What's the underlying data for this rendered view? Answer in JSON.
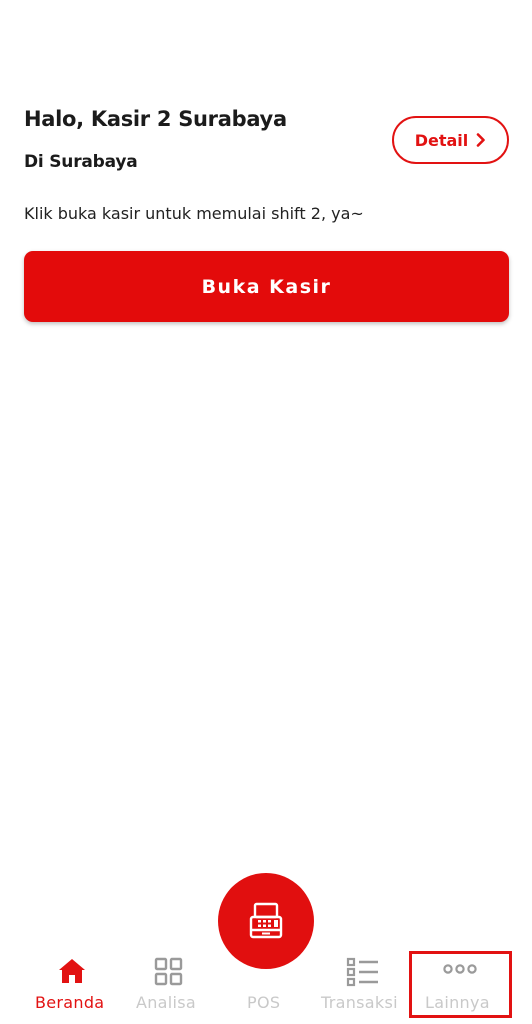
{
  "header": {
    "greeting": "Halo, Kasir 2 Surabaya",
    "location": "Di Surabaya",
    "detail_label": "Detail"
  },
  "main": {
    "instruction": "Klik buka kasir untuk memulai shift 2, ya~",
    "open_cashier_label": "Buka Kasir"
  },
  "bottom_nav": {
    "items": [
      {
        "label": "Beranda",
        "icon": "home-icon",
        "active": true
      },
      {
        "label": "Analisa",
        "icon": "grid-icon",
        "active": false
      },
      {
        "label": "POS",
        "icon": "cash-register-icon",
        "active": false
      },
      {
        "label": "Transaksi",
        "icon": "list-icon",
        "active": false
      },
      {
        "label": "Lainnya",
        "icon": "more-icon",
        "active": false
      }
    ]
  },
  "colors": {
    "accent": "#e21212",
    "inactive": "#c9c9c9",
    "text": "#1b1b1b"
  }
}
